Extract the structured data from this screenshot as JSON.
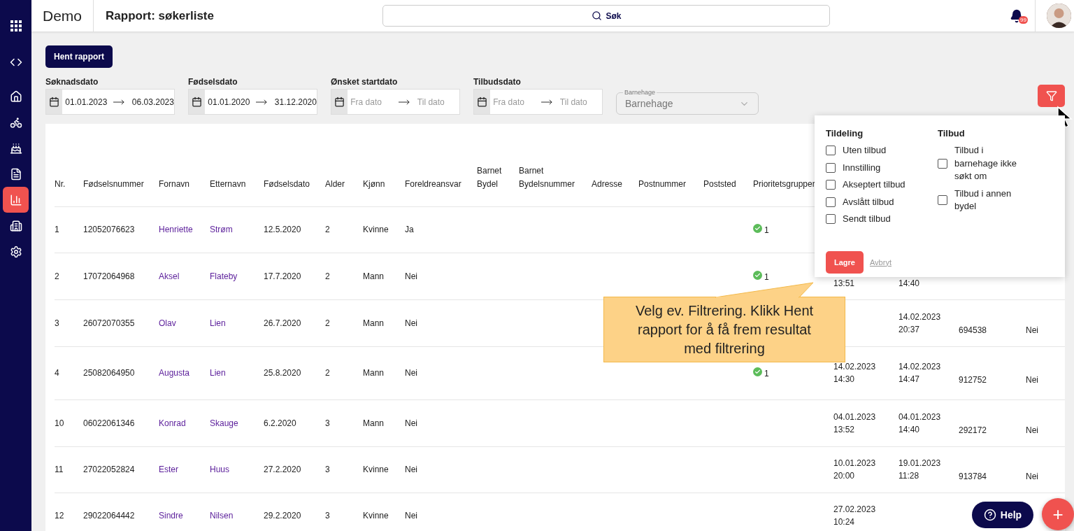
{
  "sidebar": {
    "items": [
      {
        "selected": false
      },
      {
        "selected": false
      },
      {
        "selected": false
      },
      {
        "selected": false
      },
      {
        "selected": false
      },
      {
        "selected": true
      },
      {
        "selected": false
      },
      {
        "selected": false
      }
    ]
  },
  "header": {
    "app_name": "Demo",
    "page_title": "Rapport: søkerliste",
    "search": {
      "label": "Søk"
    },
    "notifications": {
      "count": "99"
    }
  },
  "toolbar": {
    "button": "Hent rapport"
  },
  "filters": [
    {
      "label": "Søknadsdato",
      "from": {
        "value": "01.01.2023"
      },
      "to": {
        "value": "06.03.2023"
      }
    },
    {
      "label": "Fødselsdato",
      "from": {
        "value": "01.01.2020"
      },
      "to": {
        "value": "31.12.2020"
      }
    },
    {
      "label": "Ønsket startdato",
      "from": {
        "placeholder": "Fra dato"
      },
      "to": {
        "placeholder": "Til dato"
      }
    },
    {
      "label": "Tilbudsdato",
      "from": {
        "placeholder": "Fra dato"
      },
      "to": {
        "placeholder": "Til dato"
      }
    }
  ],
  "select": {
    "label": "Barnehage",
    "placeholder": "Barnehage"
  },
  "table": {
    "columns": [
      "Nr.",
      "Fødselsnummer",
      "Fornavn",
      "Etternavn",
      "Fødselsdato",
      "Alder",
      "Kjønn",
      "Foreldreansvar",
      "Barnet\nBydel",
      "Barnet\nBydelsnummer",
      "Adresse",
      "Postnummer",
      "Poststed",
      "Prioritetsgrupper"
    ],
    "rows": [
      {
        "cells": [
          "1",
          "12052076623",
          "Henriette",
          "Strøm",
          "12.5.2020",
          "2",
          "Kvinne",
          "Ja",
          null,
          null,
          null,
          null,
          null,
          {
            "kind": "priority",
            "text": "1"
          },
          null,
          null,
          null,
          null
        ]
      },
      {
        "cells": [
          "2",
          "17072064968",
          "Aksel",
          "Flateby",
          "17.7.2020",
          "2",
          "Mann",
          "Nei",
          null,
          null,
          null,
          null,
          null,
          {
            "kind": "priority",
            "text": "1"
          },
          "13:51",
          "14:40",
          null,
          null
        ]
      },
      {
        "cells": [
          "3",
          "26072070355",
          "Olav",
          "Lien",
          "26.7.2020",
          "2",
          "Mann",
          "Nei",
          null,
          null,
          null,
          null,
          null,
          null,
          null,
          "14.02.2023\n20:37",
          "694538",
          "Nei"
        ]
      },
      {
        "cells": [
          "4",
          "25082064950",
          "Augusta",
          "Lien",
          "25.8.2020",
          "2",
          "Mann",
          "Nei",
          null,
          null,
          null,
          null,
          null,
          {
            "kind": "priority",
            "text": "1"
          },
          "14.02.2023\n14:30",
          "14.02.2023\n14:47",
          "912752",
          "Nei"
        ]
      },
      {
        "cells": [
          "10",
          "06022061346",
          "Konrad",
          "Skauge",
          "6.2.2020",
          "3",
          "Mann",
          "Nei",
          null,
          null,
          null,
          null,
          null,
          null,
          "04.01.2023\n13:52",
          "04.01.2023\n14:40",
          "292172",
          "Nei"
        ]
      },
      {
        "cells": [
          "11",
          "27022052824",
          "Ester",
          "Huus",
          "27.2.2020",
          "3",
          "Kvinne",
          "Nei",
          null,
          null,
          null,
          null,
          null,
          null,
          "10.01.2023\n20:00",
          "19.01.2023\n11:28",
          "913784",
          "Nei"
        ]
      },
      {
        "cells": [
          "12",
          "29022064442",
          "Sindre",
          "Nilsen",
          "29.2.2020",
          "3",
          "Kvinne",
          "Nei",
          null,
          null,
          null,
          null,
          null,
          null,
          "27.02.2023\n10:24",
          null,
          null,
          null
        ]
      }
    ]
  },
  "filter_popover": {
    "groups": [
      {
        "title": "Tildeling",
        "options": [
          {
            "label": "Uten tilbud",
            "checked": false
          },
          {
            "label": "Innstilling",
            "checked": false
          },
          {
            "label": "Akseptert tilbud",
            "checked": false
          },
          {
            "label": "Avslått tilbud",
            "checked": false
          },
          {
            "label": "Sendt tilbud",
            "checked": false
          }
        ]
      },
      {
        "title": "Tilbud",
        "options": [
          {
            "label": "Tilbud i barnehage ikke søkt om",
            "checked": false
          },
          {
            "label": "Tilbud i annen bydel",
            "checked": false
          }
        ]
      }
    ],
    "save": "Lagre",
    "cancel": "Avbryt"
  },
  "callout": {
    "text": "Velg ev. Filtrering. Klikk Hent rapport for å få frem resultat med filtrering"
  },
  "help": {
    "label": "Help"
  },
  "fab": {
    "label": "+"
  }
}
